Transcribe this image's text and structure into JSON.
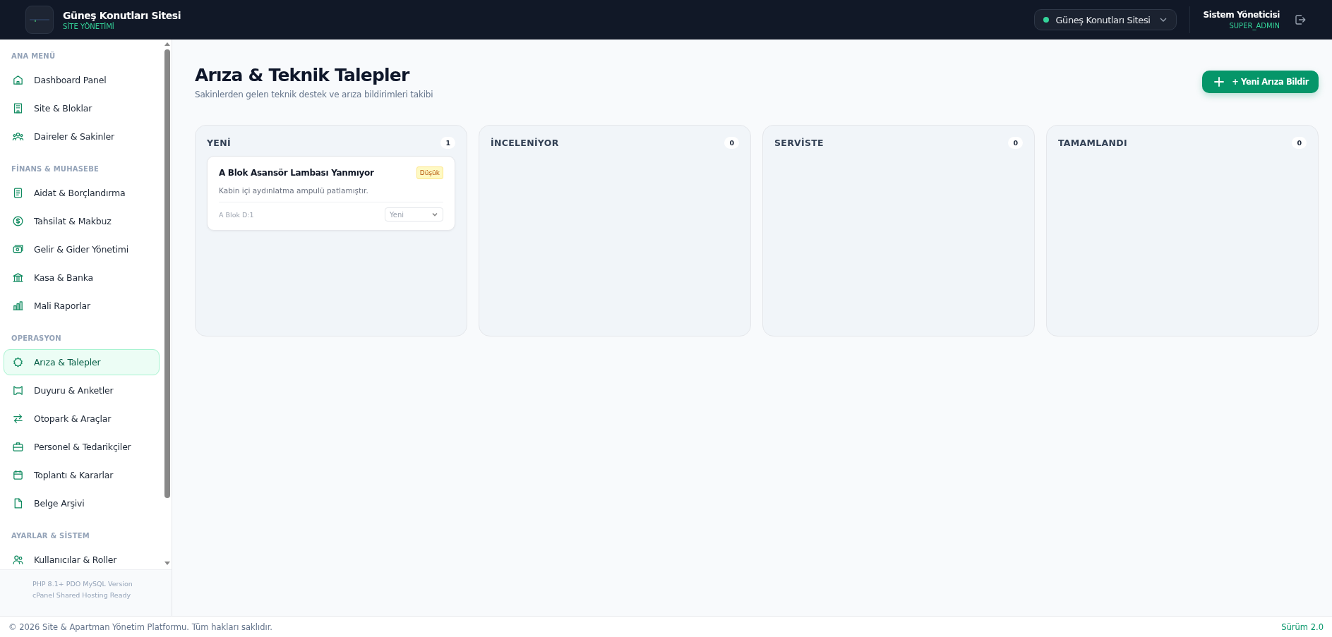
{
  "header": {
    "site_name": "Güneş Konutları Sitesi",
    "subtitle": "SİTE YÖNETİMİ",
    "site_selector": {
      "label": "Güneş Konutları Sitesi",
      "color": "#34d399"
    },
    "user": {
      "name": "Sistem Yöneticisi",
      "role": "SUPER_ADMIN"
    }
  },
  "sidebar": {
    "sections": [
      {
        "title": "ANA MENÜ",
        "items": [
          {
            "label": "Dashboard Panel",
            "selected": false
          },
          {
            "label": "Site & Bloklar",
            "selected": false
          },
          {
            "label": "Daireler & Sakinler",
            "selected": false
          }
        ]
      },
      {
        "title": "FİNANS & MUHASEBE",
        "items": [
          {
            "label": "Aidat & Borçlandırma",
            "selected": false
          },
          {
            "label": "Tahsilat & Makbuz",
            "selected": false
          },
          {
            "label": "Gelir & Gider Yönetimi",
            "selected": false
          },
          {
            "label": "Kasa & Banka",
            "selected": false
          },
          {
            "label": "Mali Raporlar",
            "selected": false
          }
        ]
      },
      {
        "title": "OPERASYON",
        "items": [
          {
            "label": "Arıza & Talepler",
            "selected": true
          },
          {
            "label": "Duyuru & Anketler",
            "selected": false
          },
          {
            "label": "Otopark & Araçlar",
            "selected": false
          },
          {
            "label": "Personel & Tedarikçiler",
            "selected": false
          },
          {
            "label": "Toplantı & Kararlar",
            "selected": false
          },
          {
            "label": "Belge Arşivi",
            "selected": false
          }
        ]
      },
      {
        "title": "AYARLAR & SİSTEM",
        "items": [
          {
            "label": "Kullanıcılar & Roller",
            "selected": false
          }
        ]
      }
    ],
    "footer_lines": [
      "PHP 8.1+ PDO MySQL Version",
      "cPanel Shared Hosting Ready"
    ]
  },
  "page": {
    "title": "Arıza & Teknik Talepler",
    "subtitle": "Sakinlerden gelen teknik destek ve arıza bildirimleri takibi",
    "new_button": "+ Yeni Arıza Bildir"
  },
  "board": {
    "columns": [
      {
        "title": "YENİ",
        "count": "1",
        "cards": [
          {
            "title": "A Blok Asansör Lambası Yanmıyor",
            "priority": "Düşük",
            "description": "Kabin içi aydınlatma ampulü patlamıştır.",
            "location": "A Blok D:1",
            "status": "Yeni"
          }
        ]
      },
      {
        "title": "İNCELENİYOR",
        "count": "0"
      },
      {
        "title": "SERVİSTE",
        "count": "0"
      },
      {
        "title": "TAMAMLANDI",
        "count": "0"
      }
    ]
  },
  "footer": {
    "copyright": "© 2026 Site & Apartman Yönetim Platformu. Tüm hakları saklıdır.",
    "version": "Sürüm 2.0"
  }
}
